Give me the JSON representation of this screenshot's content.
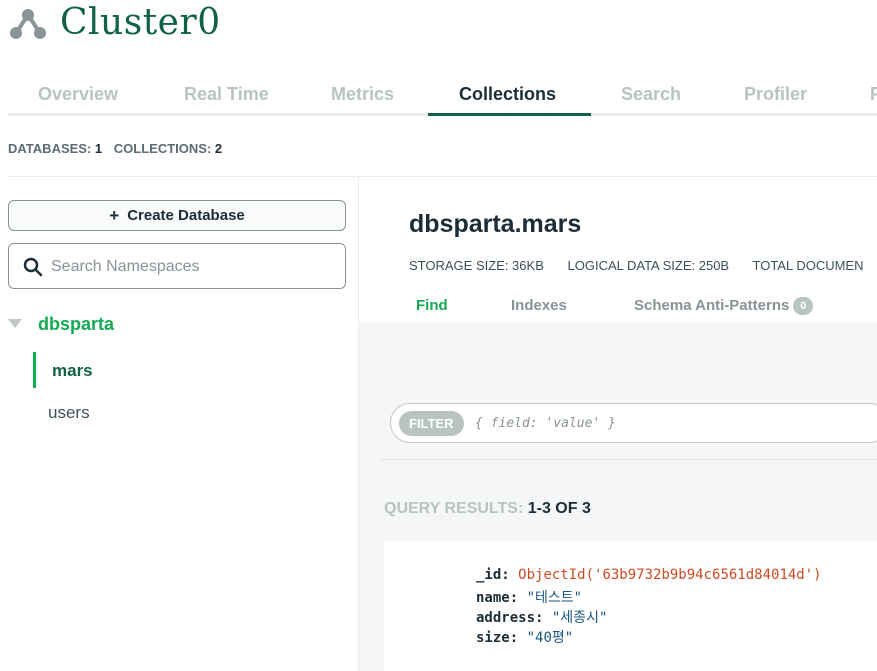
{
  "header": {
    "title": "Cluster0"
  },
  "tabs": [
    "Overview",
    "Real Time",
    "Metrics",
    "Collections",
    "Search",
    "Profiler",
    "P"
  ],
  "counts": {
    "databases_label": "DATABASES:",
    "databases_value": "1",
    "collections_label": "COLLECTIONS:",
    "collections_value": "2"
  },
  "sidebar": {
    "create_button": "Create Database",
    "search_placeholder": "Search Namespaces",
    "database": "dbsparta",
    "collections": [
      "mars",
      "users"
    ]
  },
  "main": {
    "namespace": "dbsparta.mars",
    "stats": {
      "storage": "STORAGE SIZE: 36KB",
      "logical": "LOGICAL DATA SIZE: 250B",
      "total": "TOTAL DOCUMEN"
    },
    "sub_tabs": {
      "find": "Find",
      "indexes": "Indexes",
      "schema": "Schema Anti-Patterns",
      "schema_badge": "0"
    },
    "filter": {
      "pill": "FILTER",
      "placeholder": "{ field: 'value' }"
    },
    "results": {
      "label": "QUERY RESULTS:",
      "count": "1-3 OF 3"
    },
    "document": {
      "id_key": "_id:",
      "id_value": "ObjectId('63b9732b9b94c6561d84014d')",
      "name_key": "name:",
      "name_value": "\"테스트\"",
      "address_key": "address:",
      "address_value": "\"세종시\"",
      "size_key": "size:",
      "size_value": "\"40평\""
    }
  },
  "colors": {
    "brand": "#116149",
    "accent": "#13aa52",
    "oid": "#cf4a22",
    "string": "#1a567e"
  }
}
